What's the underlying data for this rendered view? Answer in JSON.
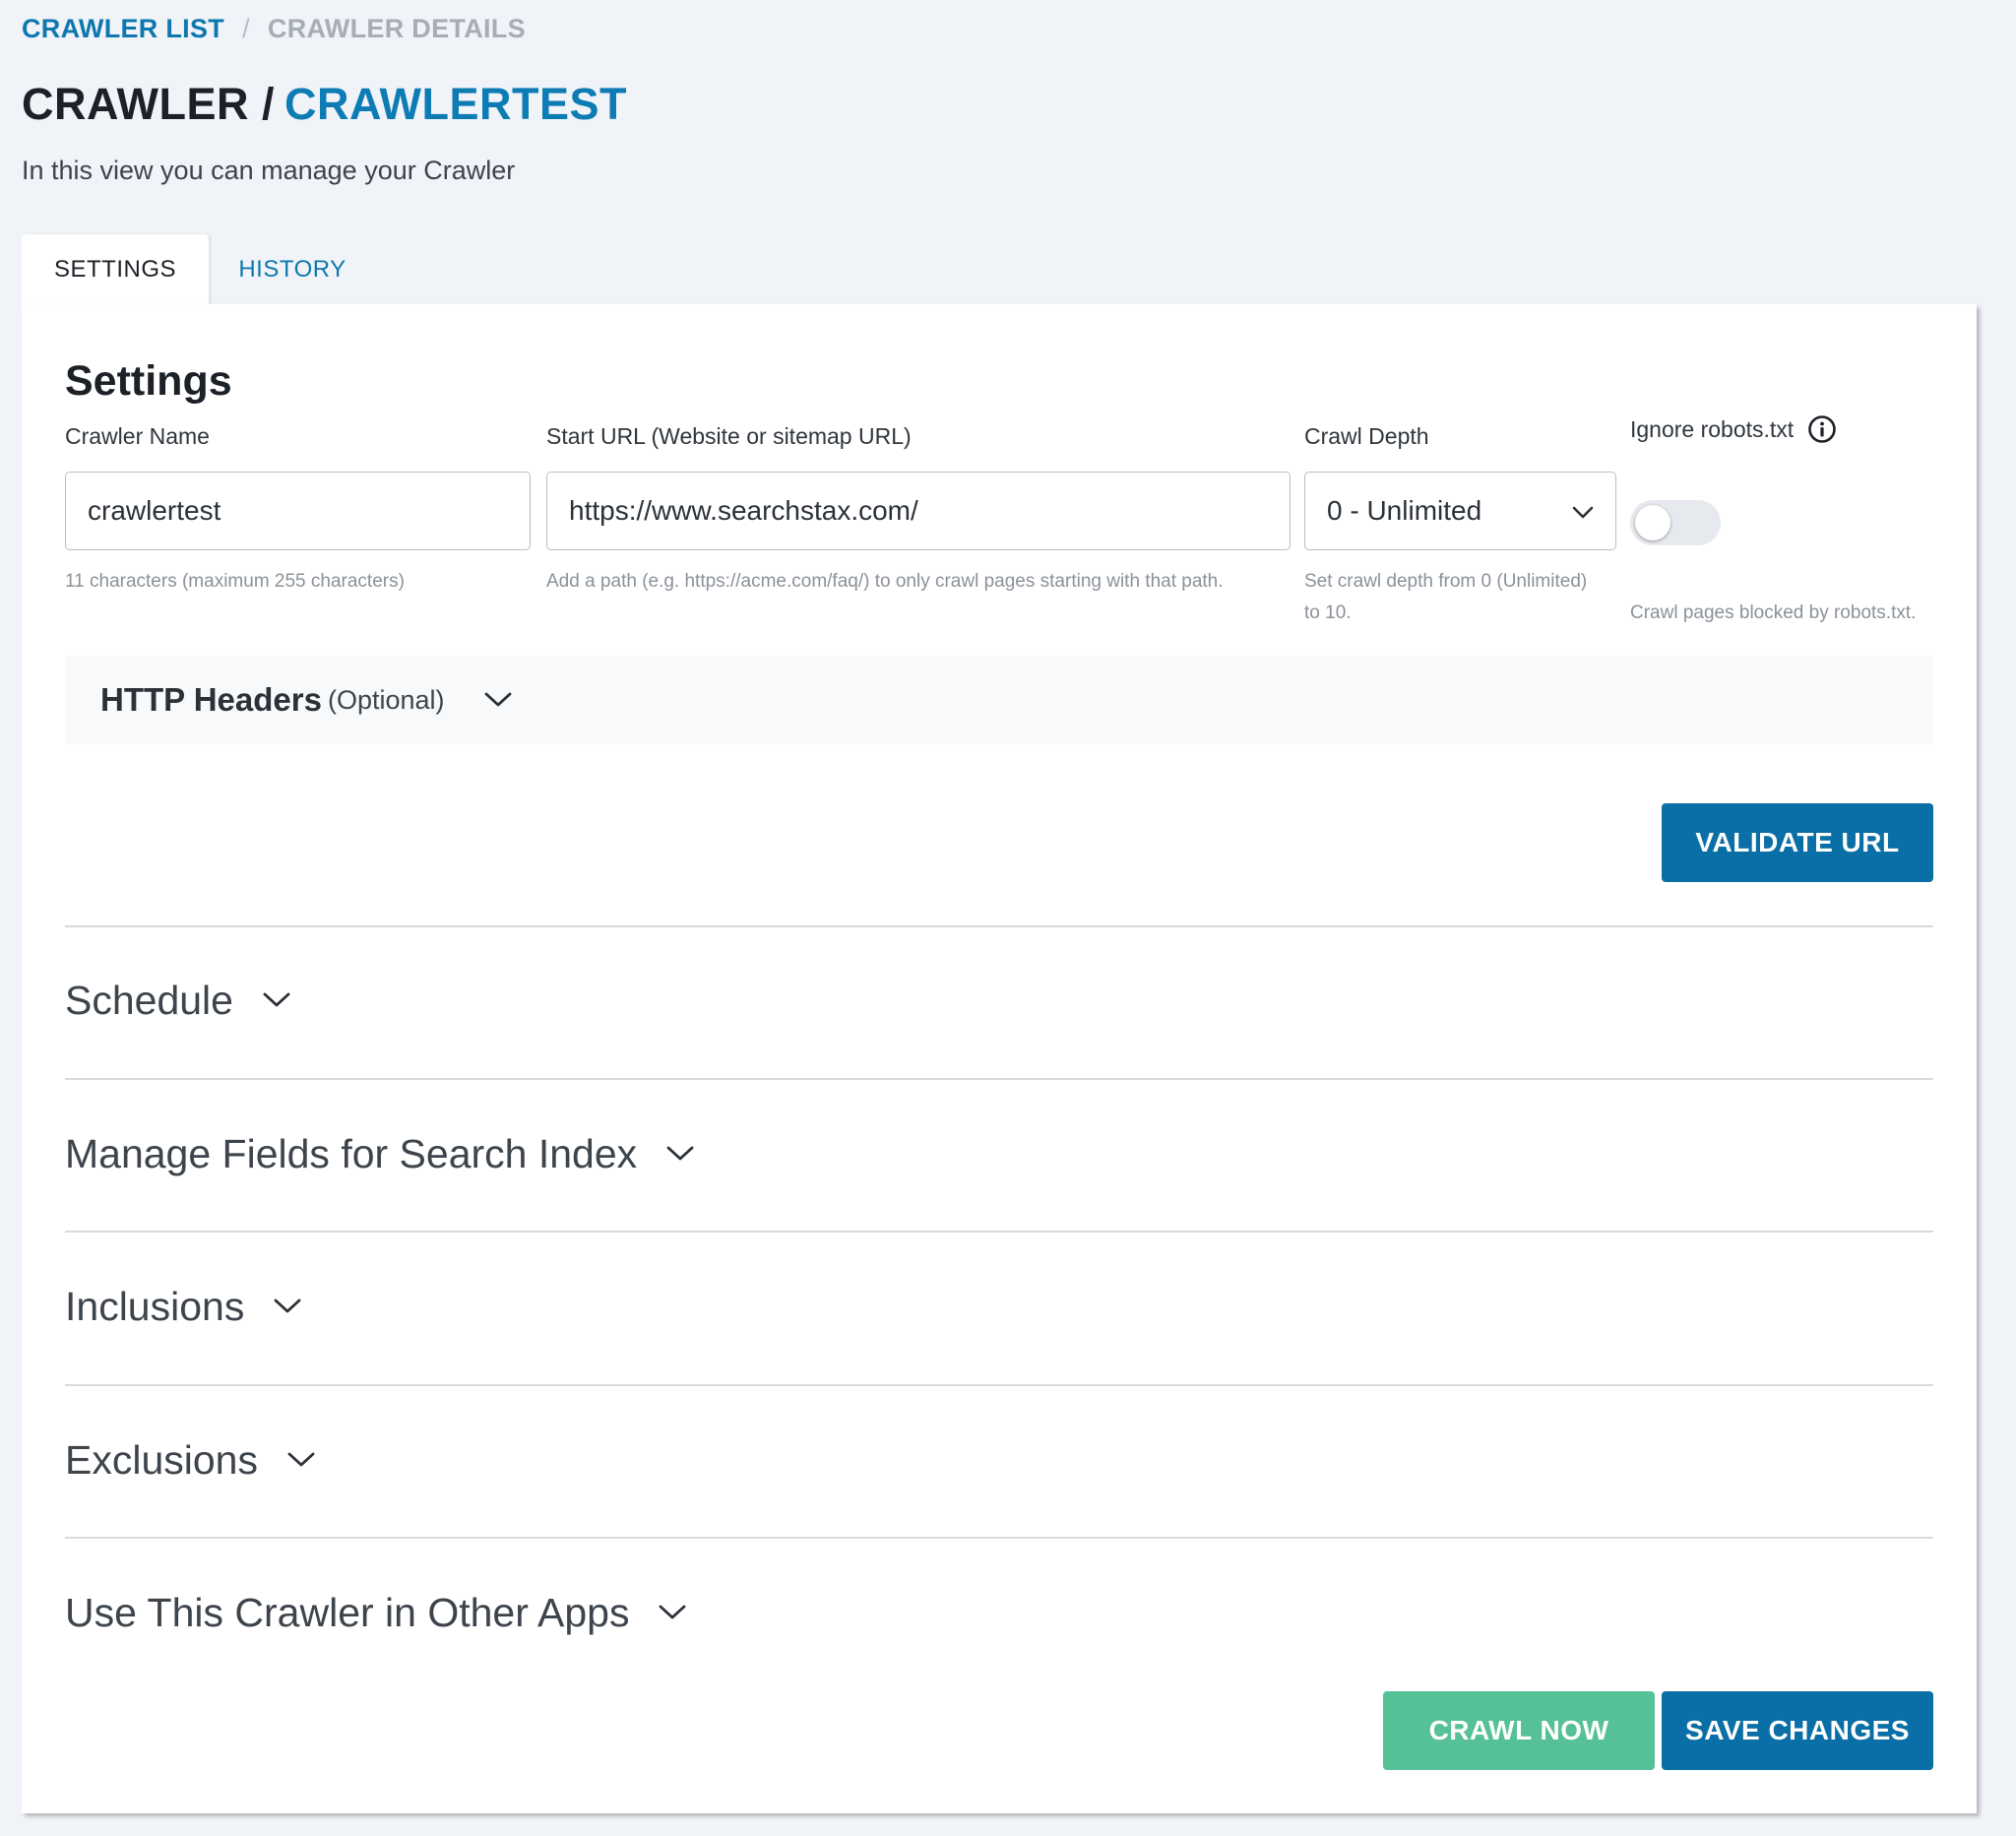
{
  "breadcrumb": {
    "items": [
      {
        "label": "CRAWLER LIST"
      },
      {
        "label": "CRAWLER DETAILS"
      }
    ],
    "separator": "/"
  },
  "header": {
    "title_prefix": "CRAWLER /",
    "title_name": "CRAWLERTEST",
    "subtitle": "In this view you can manage your Crawler"
  },
  "tabs": [
    {
      "label": "SETTINGS",
      "active": true
    },
    {
      "label": "HISTORY",
      "active": false
    }
  ],
  "settings": {
    "heading": "Settings",
    "crawler_name": {
      "label": "Crawler Name",
      "value": "crawlertest",
      "help": "11 characters (maximum 255 characters)"
    },
    "start_url": {
      "label": "Start URL (Website or sitemap URL)",
      "value": "https://www.searchstax.com/",
      "help": "Add a path (e.g. https://acme.com/faq/) to only crawl pages starting with that path."
    },
    "crawl_depth": {
      "label": "Crawl Depth",
      "selected": "0 - Unlimited",
      "help_line1": "Set crawl depth from 0 (Unlimited)",
      "help_line2": "to 10."
    },
    "ignore_robots": {
      "label": "Ignore robots.txt",
      "enabled": false,
      "help": "Crawl pages blocked by robots.txt."
    },
    "http_headers": {
      "title": "HTTP Headers",
      "optional": "(Optional)"
    },
    "validate_label": "VALIDATE URL"
  },
  "sections": [
    {
      "title": "Schedule"
    },
    {
      "title": "Manage Fields for Search Index"
    },
    {
      "title": "Inclusions"
    },
    {
      "title": "Exclusions"
    },
    {
      "title": "Use This Crawler in Other Apps"
    }
  ],
  "actions": {
    "crawl_now": "CRAWL NOW",
    "save_changes": "SAVE CHANGES"
  },
  "colors": {
    "accent": "#0e78ae",
    "primary_button": "#0a6fa6",
    "success_button": "#56c196",
    "page_background": "#f0f3f8"
  },
  "icons": {
    "info": "info-circle-icon",
    "chevron": "chevron-down-icon"
  }
}
